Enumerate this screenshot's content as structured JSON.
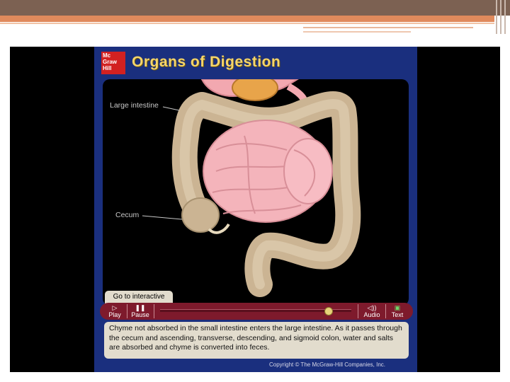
{
  "animation": {
    "logo_lines": [
      "Mc",
      "Graw",
      "Hill"
    ],
    "title": "Organs of Digestion",
    "labels": {
      "large_intestine": "Large intestine",
      "cecum": "Cecum"
    },
    "interactive_tab": "Go to interactive",
    "controls": {
      "play": "Play",
      "pause": "Pause",
      "audio": "Audio",
      "text": "Text",
      "progress": 0.88
    },
    "caption": "Chyme not absorbed in the small intestine enters the large intestine. As it passes through the cecum and ascending, transverse, descending, and sigmoid colon, water and salts are absorbed and chyme is converted into feces.",
    "copyright": "Copyright © The McGraw-Hill Companies, Inc."
  },
  "colors": {
    "panel_blue": "#1a2f7e",
    "title_gold": "#f5d56a",
    "control_maroon": "#7e1a2c",
    "caption_bg": "#e2dccd",
    "logo_red": "#d22121",
    "slide_header_brown": "#7c6152",
    "slide_header_orange": "#e08a5c"
  }
}
